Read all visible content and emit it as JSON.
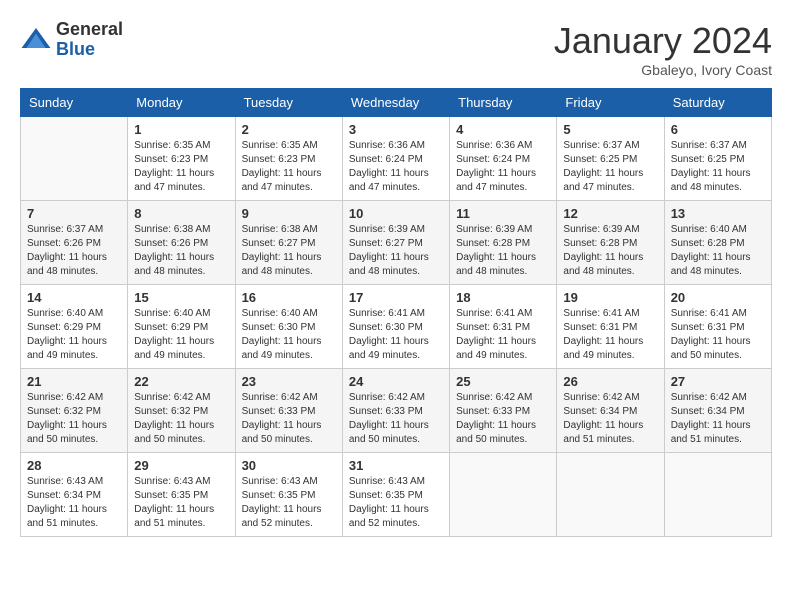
{
  "header": {
    "logo_general": "General",
    "logo_blue": "Blue",
    "month_title": "January 2024",
    "location": "Gbaleyo, Ivory Coast"
  },
  "weekdays": [
    "Sunday",
    "Monday",
    "Tuesday",
    "Wednesday",
    "Thursday",
    "Friday",
    "Saturday"
  ],
  "weeks": [
    [
      {
        "day": "",
        "sunrise": "",
        "sunset": "",
        "daylight": ""
      },
      {
        "day": "1",
        "sunrise": "Sunrise: 6:35 AM",
        "sunset": "Sunset: 6:23 PM",
        "daylight": "Daylight: 11 hours and 47 minutes."
      },
      {
        "day": "2",
        "sunrise": "Sunrise: 6:35 AM",
        "sunset": "Sunset: 6:23 PM",
        "daylight": "Daylight: 11 hours and 47 minutes."
      },
      {
        "day": "3",
        "sunrise": "Sunrise: 6:36 AM",
        "sunset": "Sunset: 6:24 PM",
        "daylight": "Daylight: 11 hours and 47 minutes."
      },
      {
        "day": "4",
        "sunrise": "Sunrise: 6:36 AM",
        "sunset": "Sunset: 6:24 PM",
        "daylight": "Daylight: 11 hours and 47 minutes."
      },
      {
        "day": "5",
        "sunrise": "Sunrise: 6:37 AM",
        "sunset": "Sunset: 6:25 PM",
        "daylight": "Daylight: 11 hours and 47 minutes."
      },
      {
        "day": "6",
        "sunrise": "Sunrise: 6:37 AM",
        "sunset": "Sunset: 6:25 PM",
        "daylight": "Daylight: 11 hours and 48 minutes."
      }
    ],
    [
      {
        "day": "7",
        "sunrise": "Sunrise: 6:37 AM",
        "sunset": "Sunset: 6:26 PM",
        "daylight": "Daylight: 11 hours and 48 minutes."
      },
      {
        "day": "8",
        "sunrise": "Sunrise: 6:38 AM",
        "sunset": "Sunset: 6:26 PM",
        "daylight": "Daylight: 11 hours and 48 minutes."
      },
      {
        "day": "9",
        "sunrise": "Sunrise: 6:38 AM",
        "sunset": "Sunset: 6:27 PM",
        "daylight": "Daylight: 11 hours and 48 minutes."
      },
      {
        "day": "10",
        "sunrise": "Sunrise: 6:39 AM",
        "sunset": "Sunset: 6:27 PM",
        "daylight": "Daylight: 11 hours and 48 minutes."
      },
      {
        "day": "11",
        "sunrise": "Sunrise: 6:39 AM",
        "sunset": "Sunset: 6:28 PM",
        "daylight": "Daylight: 11 hours and 48 minutes."
      },
      {
        "day": "12",
        "sunrise": "Sunrise: 6:39 AM",
        "sunset": "Sunset: 6:28 PM",
        "daylight": "Daylight: 11 hours and 48 minutes."
      },
      {
        "day": "13",
        "sunrise": "Sunrise: 6:40 AM",
        "sunset": "Sunset: 6:28 PM",
        "daylight": "Daylight: 11 hours and 48 minutes."
      }
    ],
    [
      {
        "day": "14",
        "sunrise": "Sunrise: 6:40 AM",
        "sunset": "Sunset: 6:29 PM",
        "daylight": "Daylight: 11 hours and 49 minutes."
      },
      {
        "day": "15",
        "sunrise": "Sunrise: 6:40 AM",
        "sunset": "Sunset: 6:29 PM",
        "daylight": "Daylight: 11 hours and 49 minutes."
      },
      {
        "day": "16",
        "sunrise": "Sunrise: 6:40 AM",
        "sunset": "Sunset: 6:30 PM",
        "daylight": "Daylight: 11 hours and 49 minutes."
      },
      {
        "day": "17",
        "sunrise": "Sunrise: 6:41 AM",
        "sunset": "Sunset: 6:30 PM",
        "daylight": "Daylight: 11 hours and 49 minutes."
      },
      {
        "day": "18",
        "sunrise": "Sunrise: 6:41 AM",
        "sunset": "Sunset: 6:31 PM",
        "daylight": "Daylight: 11 hours and 49 minutes."
      },
      {
        "day": "19",
        "sunrise": "Sunrise: 6:41 AM",
        "sunset": "Sunset: 6:31 PM",
        "daylight": "Daylight: 11 hours and 49 minutes."
      },
      {
        "day": "20",
        "sunrise": "Sunrise: 6:41 AM",
        "sunset": "Sunset: 6:31 PM",
        "daylight": "Daylight: 11 hours and 50 minutes."
      }
    ],
    [
      {
        "day": "21",
        "sunrise": "Sunrise: 6:42 AM",
        "sunset": "Sunset: 6:32 PM",
        "daylight": "Daylight: 11 hours and 50 minutes."
      },
      {
        "day": "22",
        "sunrise": "Sunrise: 6:42 AM",
        "sunset": "Sunset: 6:32 PM",
        "daylight": "Daylight: 11 hours and 50 minutes."
      },
      {
        "day": "23",
        "sunrise": "Sunrise: 6:42 AM",
        "sunset": "Sunset: 6:33 PM",
        "daylight": "Daylight: 11 hours and 50 minutes."
      },
      {
        "day": "24",
        "sunrise": "Sunrise: 6:42 AM",
        "sunset": "Sunset: 6:33 PM",
        "daylight": "Daylight: 11 hours and 50 minutes."
      },
      {
        "day": "25",
        "sunrise": "Sunrise: 6:42 AM",
        "sunset": "Sunset: 6:33 PM",
        "daylight": "Daylight: 11 hours and 50 minutes."
      },
      {
        "day": "26",
        "sunrise": "Sunrise: 6:42 AM",
        "sunset": "Sunset: 6:34 PM",
        "daylight": "Daylight: 11 hours and 51 minutes."
      },
      {
        "day": "27",
        "sunrise": "Sunrise: 6:42 AM",
        "sunset": "Sunset: 6:34 PM",
        "daylight": "Daylight: 11 hours and 51 minutes."
      }
    ],
    [
      {
        "day": "28",
        "sunrise": "Sunrise: 6:43 AM",
        "sunset": "Sunset: 6:34 PM",
        "daylight": "Daylight: 11 hours and 51 minutes."
      },
      {
        "day": "29",
        "sunrise": "Sunrise: 6:43 AM",
        "sunset": "Sunset: 6:35 PM",
        "daylight": "Daylight: 11 hours and 51 minutes."
      },
      {
        "day": "30",
        "sunrise": "Sunrise: 6:43 AM",
        "sunset": "Sunset: 6:35 PM",
        "daylight": "Daylight: 11 hours and 52 minutes."
      },
      {
        "day": "31",
        "sunrise": "Sunrise: 6:43 AM",
        "sunset": "Sunset: 6:35 PM",
        "daylight": "Daylight: 11 hours and 52 minutes."
      },
      {
        "day": "",
        "sunrise": "",
        "sunset": "",
        "daylight": ""
      },
      {
        "day": "",
        "sunrise": "",
        "sunset": "",
        "daylight": ""
      },
      {
        "day": "",
        "sunrise": "",
        "sunset": "",
        "daylight": ""
      }
    ]
  ]
}
